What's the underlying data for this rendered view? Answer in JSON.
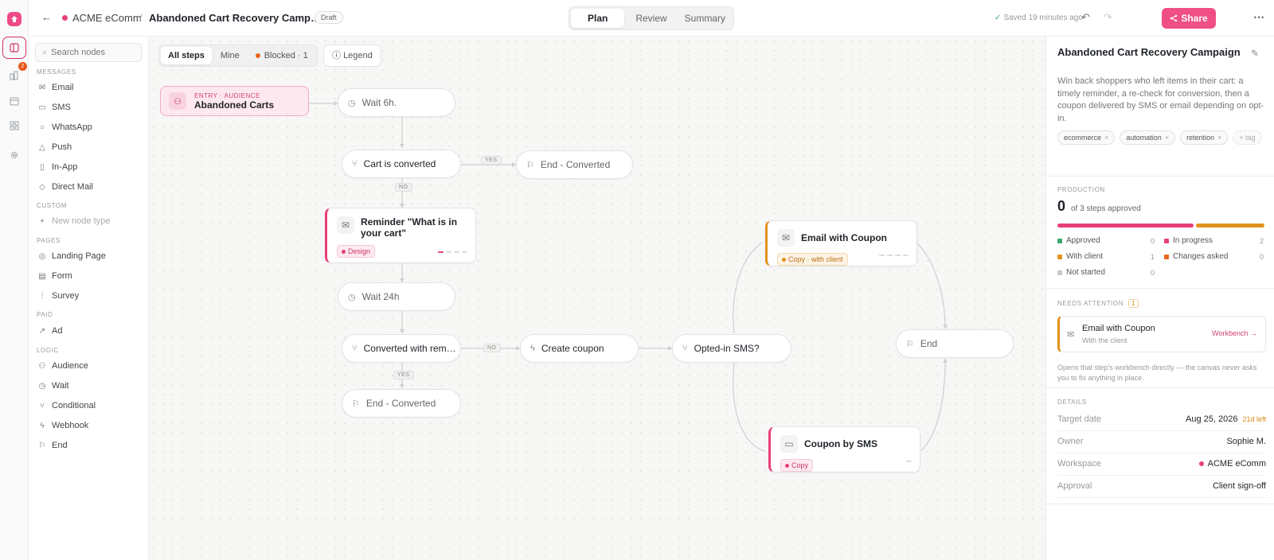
{
  "colors": {
    "accent": "#ef4f86",
    "approved": "#3aa76d",
    "in_progress": "#e83e7b",
    "with_client": "#e0921a",
    "changes_asked": "#e8661e",
    "not_started": "#c8c8c8"
  },
  "rail": {
    "badge": "2"
  },
  "topbar": {
    "workspace": "ACME eComm",
    "separator": "/",
    "title": "Abandoned Cart Recovery Camp…",
    "status": "Draft",
    "tabs": [
      "Plan",
      "Review",
      "Summary"
    ],
    "saved": "Saved 19 minutes ago",
    "share": "Share"
  },
  "palette": {
    "search_placeholder": "Search nodes",
    "sections": {
      "messages": "MESSAGES",
      "custom": "CUSTOM",
      "pages": "PAGES",
      "paid": "PAID",
      "logic": "LOGIC"
    },
    "messages": [
      "Email",
      "SMS",
      "WhatsApp",
      "Push",
      "In-App",
      "Direct Mail"
    ],
    "custom": [
      "New node type"
    ],
    "pages": [
      "Landing Page",
      "Form",
      "Survey"
    ],
    "paid": [
      "Ad"
    ],
    "logic": [
      "Audience",
      "Wait",
      "Conditional",
      "Webhook",
      "End"
    ]
  },
  "canvas": {
    "filters": [
      "All steps",
      "Mine",
      "Blocked · 1"
    ],
    "legend": "Legend",
    "entry": {
      "label": "ENTRY · AUDIENCE",
      "title": "Abandoned Carts"
    },
    "nodes": {
      "wait6": "Wait 6h.",
      "cart_converted": "Cart is converted",
      "end_converted_1": "End - Converted",
      "reminder": "Reminder \"What is in your cart\"",
      "reminder_tag": "Design",
      "wait24": "Wait 24h",
      "converted_rem": "Converted with rem…",
      "end_converted_2": "End - Converted",
      "create_coupon": "Create coupon",
      "opted_sms": "Opted-in SMS?",
      "email_coupon": "Email with Coupon",
      "email_coupon_tag": "Copy · with client",
      "coupon_sms": "Coupon by SMS",
      "coupon_sms_tag": "Copy",
      "end": "End"
    },
    "edge_labels": {
      "yes1": "YES",
      "no1": "NO",
      "no2": "NO",
      "yes2": "YES"
    }
  },
  "panel": {
    "title": "Abandoned Cart Recovery Campaign",
    "description": "Win back shoppers who left items in their cart: a timely reminder, a re-check for conversion, then a coupon delivered by SMS or email depending on opt-in.",
    "tags": [
      "ecommerce",
      "automation",
      "retention"
    ],
    "add_tag": "+ tag",
    "production_label": "PRODUCTION",
    "approved_count": "0",
    "approved_of": "of 3 steps approved",
    "progress": {
      "in_progress": 2,
      "with_client": 1,
      "total": 3
    },
    "statuses": [
      {
        "label": "Approved",
        "value": "0"
      },
      {
        "label": "In progress",
        "value": "2"
      },
      {
        "label": "With client",
        "value": "1"
      },
      {
        "label": "Changes asked",
        "value": "0"
      },
      {
        "label": "Not started",
        "value": "0"
      }
    ],
    "attention_label": "NEEDS ATTENTION",
    "attention_count": "1",
    "attention_item": {
      "title": "Email with Coupon",
      "subtitle": "With the client",
      "action": "Workbench →"
    },
    "hint": "Opens that step's workbench directly — the canvas never asks you to fix anything in place.",
    "details_label": "DETAILS",
    "details": [
      {
        "key": "Target date",
        "value": "Aug 25, 2026",
        "extra": "21d left"
      },
      {
        "key": "Owner",
        "value": "Sophie M."
      },
      {
        "key": "Workspace",
        "value": "ACME eComm"
      },
      {
        "key": "Approval",
        "value": "Client sign-off"
      }
    ]
  }
}
